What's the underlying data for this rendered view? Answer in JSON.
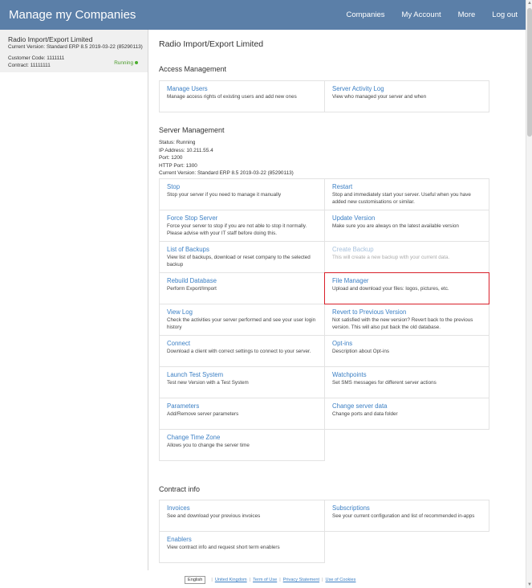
{
  "header": {
    "title": "Manage my Companies",
    "nav": [
      "Companies",
      "My Account",
      "More",
      "Log out"
    ]
  },
  "sidebar": {
    "company": {
      "name": "Radio Import/Export Limited",
      "version": "Current Version: Standard ERP 8.5 2019-03-22 (85290113)",
      "customer_code": "Customer Code: 1111111",
      "contract": "Contract: 11111111",
      "status": "Running"
    }
  },
  "main": {
    "title": "Radio Import/Export Limited",
    "access": {
      "heading": "Access Management",
      "cards": [
        {
          "title": "Manage Users",
          "desc": "Manage access rights of existing users and add new ones"
        },
        {
          "title": "Server Activity Log",
          "desc": "View who managed your server and when"
        }
      ]
    },
    "server": {
      "heading": "Server Management",
      "info": [
        "Status: Running",
        "IP Address: 10.211.55.4",
        "Port: 1200",
        "HTTP Port: 1300",
        "Current Version: Standard ERP 8.5 2019-03-22 (85290113)"
      ],
      "cards": [
        {
          "title": "Stop",
          "desc": "Stop your server if you need to manage it manually"
        },
        {
          "title": "Restart",
          "desc": "Stop and immediately start your server. Useful when you have added new customisations or similar."
        },
        {
          "title": "Force Stop Server",
          "desc": "Force your server to stop if you are not able to stop it normally. Please advise with your IT staff before doing this."
        },
        {
          "title": "Update Version",
          "desc": "Make sure you are always on the latest available version"
        },
        {
          "title": "List of Backups",
          "desc": "View list of backups, download or reset company to the selected backup"
        },
        {
          "title": "Create Backup",
          "desc": "This will create a new backup with your current data."
        },
        {
          "title": "Rebuild Database",
          "desc": "Perform Export/Import"
        },
        {
          "title": "File Manager",
          "desc": "Upload and download your files: logos, pictures, etc."
        },
        {
          "title": "View Log",
          "desc": "Check the activities your server performed and see your user login history"
        },
        {
          "title": "Revert to Previous Version",
          "desc": "Not satisfied with the new version? Revert back to the previous version. This will also put back the old database."
        },
        {
          "title": "Connect",
          "desc": "Download a client with correct settings to connect to your server."
        },
        {
          "title": "Opt-ins",
          "desc": "Description about Opt-ins"
        },
        {
          "title": "Launch Test System",
          "desc": "Test new Version with a Test System"
        },
        {
          "title": "Watchpoints",
          "desc": "Set SMS messages for different server actions"
        },
        {
          "title": "Parameters",
          "desc": "Add/Remove server parameters"
        },
        {
          "title": "Change server data",
          "desc": "Change ports and data folder"
        },
        {
          "title": "Change Time Zone",
          "desc": "Allows you to change the server time"
        }
      ]
    },
    "contract": {
      "heading": "Contract info",
      "cards": [
        {
          "title": "Invoices",
          "desc": "See and download your previous invoices"
        },
        {
          "title": "Subscriptions",
          "desc": "See your current configuration and list of recommended in-apps"
        },
        {
          "title": "Enablers",
          "desc": "View contract info and request short term enablers"
        }
      ]
    }
  },
  "footer": {
    "language": "English",
    "links": [
      "United Kingdom",
      "Term of Use",
      "Privacy Statement",
      "Use of Cookies"
    ]
  },
  "colors": {
    "header_bg": "#5b7fa8",
    "link": "#3b7fc4",
    "running": "#4cae2f",
    "highlight": "#d9202a"
  }
}
